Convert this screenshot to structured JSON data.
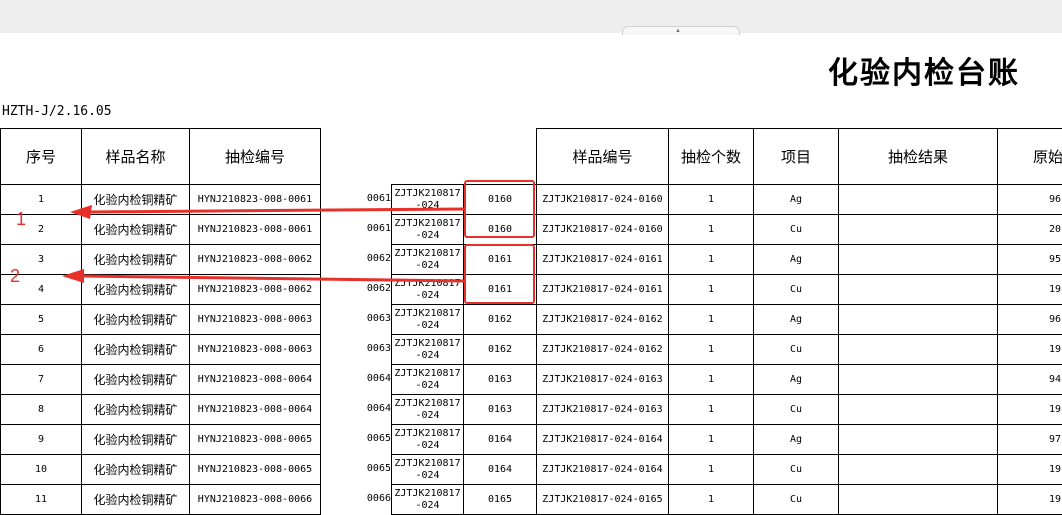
{
  "title": "化验内检台账",
  "doc_no": "HZTH-J/2.16.05",
  "headers": {
    "seq": "序号",
    "sample_name": "样品名称",
    "check_no": "抽检编号",
    "sample_no": "样品编号",
    "check_count": "抽检个数",
    "item": "项目",
    "result": "抽检结果",
    "original": "原始"
  },
  "rows": [
    {
      "seq": "1",
      "name": "化验内检铜精矿",
      "check_no": "HYNJ210823-008-0061",
      "short": "0061",
      "code1": "ZJTJK210817",
      "code2": "-024",
      "id": "0160",
      "sample_no": "ZJTJK210817-024-0160",
      "count": "1",
      "item": "Ag",
      "orig": "96"
    },
    {
      "seq": "2",
      "name": "化验内检铜精矿",
      "check_no": "HYNJ210823-008-0061",
      "short": "0061",
      "code1": "ZJTJK210817",
      "code2": "-024",
      "id": "0160",
      "sample_no": "ZJTJK210817-024-0160",
      "count": "1",
      "item": "Cu",
      "orig": "20"
    },
    {
      "seq": "3",
      "name": "化验内检铜精矿",
      "check_no": "HYNJ210823-008-0062",
      "short": "0062",
      "code1": "ZJTJK210817",
      "code2": "-024",
      "id": "0161",
      "sample_no": "ZJTJK210817-024-0161",
      "count": "1",
      "item": "Ag",
      "orig": "95"
    },
    {
      "seq": "4",
      "name": "化验内检铜精矿",
      "check_no": "HYNJ210823-008-0062",
      "short": "0062",
      "code1": "ZJTJK210817",
      "code2": "-024",
      "id": "0161",
      "sample_no": "ZJTJK210817-024-0161",
      "count": "1",
      "item": "Cu",
      "orig": "19"
    },
    {
      "seq": "5",
      "name": "化验内检铜精矿",
      "check_no": "HYNJ210823-008-0063",
      "short": "0063",
      "code1": "ZJTJK210817",
      "code2": "-024",
      "id": "0162",
      "sample_no": "ZJTJK210817-024-0162",
      "count": "1",
      "item": "Ag",
      "orig": "96"
    },
    {
      "seq": "6",
      "name": "化验内检铜精矿",
      "check_no": "HYNJ210823-008-0063",
      "short": "0063",
      "code1": "ZJTJK210817",
      "code2": "-024",
      "id": "0162",
      "sample_no": "ZJTJK210817-024-0162",
      "count": "1",
      "item": "Cu",
      "orig": "19"
    },
    {
      "seq": "7",
      "name": "化验内检铜精矿",
      "check_no": "HYNJ210823-008-0064",
      "short": "0064",
      "code1": "ZJTJK210817",
      "code2": "-024",
      "id": "0163",
      "sample_no": "ZJTJK210817-024-0163",
      "count": "1",
      "item": "Ag",
      "orig": "94"
    },
    {
      "seq": "8",
      "name": "化验内检铜精矿",
      "check_no": "HYNJ210823-008-0064",
      "short": "0064",
      "code1": "ZJTJK210817",
      "code2": "-024",
      "id": "0163",
      "sample_no": "ZJTJK210817-024-0163",
      "count": "1",
      "item": "Cu",
      "orig": "19"
    },
    {
      "seq": "9",
      "name": "化验内检铜精矿",
      "check_no": "HYNJ210823-008-0065",
      "short": "0065",
      "code1": "ZJTJK210817",
      "code2": "-024",
      "id": "0164",
      "sample_no": "ZJTJK210817-024-0164",
      "count": "1",
      "item": "Ag",
      "orig": "97"
    },
    {
      "seq": "10",
      "name": "化验内检铜精矿",
      "check_no": "HYNJ210823-008-0065",
      "short": "0065",
      "code1": "ZJTJK210817",
      "code2": "-024",
      "id": "0164",
      "sample_no": "ZJTJK210817-024-0164",
      "count": "1",
      "item": "Cu",
      "orig": "19"
    },
    {
      "seq": "11",
      "name": "化验内检铜精矿",
      "check_no": "HYNJ210823-008-0066",
      "short": "0066",
      "code1": "ZJTJK210817",
      "code2": "-024",
      "id": "0165",
      "sample_no": "ZJTJK210817-024-0165",
      "count": "1",
      "item": "Cu",
      "orig": "19"
    }
  ],
  "annotations": {
    "labels": [
      "1",
      "2"
    ],
    "color": "#e8302a"
  }
}
